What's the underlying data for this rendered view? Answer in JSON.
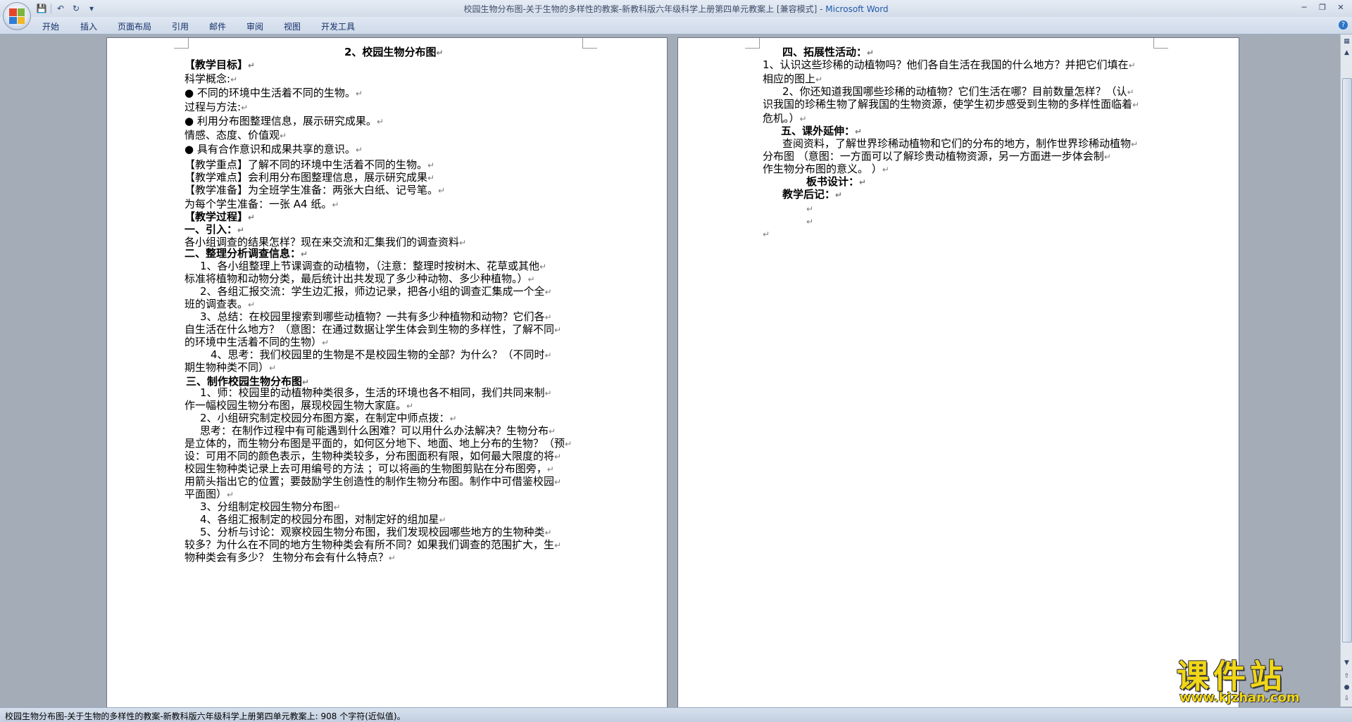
{
  "window": {
    "title": "校园生物分布图-关于生物的多样性的教案-新教科版六年级科学上册第四单元教案上 [兼容模式] - ",
    "app_name": "Microsoft Word"
  },
  "qat": [
    "save-icon",
    "undo-icon",
    "redo-icon",
    "customize-icon"
  ],
  "ribbon_tabs": [
    "开始",
    "插入",
    "页面布局",
    "引用",
    "邮件",
    "审阅",
    "视图",
    "开发工具"
  ],
  "left_page_lines": [
    {
      "text": "2、校园生物分布图",
      "b": true
    },
    {
      "text": "【教学目标】",
      "b": true
    },
    {
      "text": "科学概念:",
      "b": false
    },
    {
      "text": "● 不同的环境中生活着不同的生物。",
      "b": false
    },
    {
      "text": "过程与方法:",
      "b": false
    },
    {
      "text": "● 利用分布图整理信息，展示研究成果。",
      "b": false
    },
    {
      "text": "情感、态度、价值观",
      "b": false
    },
    {
      "text": "● 具有合作意识和成果共享的意识。",
      "b": false
    },
    {
      "text": "【教学重点】了解不同的环境中生活着不同的生物。",
      "b": false
    },
    {
      "text": "【教学难点】会利用分布图整理信息，展示研究成果",
      "b": false
    },
    {
      "text": "【教学准备】为全班学生准备：两张大白纸、记号笔。",
      "b": false
    },
    {
      "text": "为每个学生准备：一张 A4 纸。",
      "b": false
    },
    {
      "text": "【教学过程】",
      "b": true
    },
    {
      "text": "一、引入：",
      "b": true
    },
    {
      "text": "各小组调查的结果怎样？现在来交流和汇集我们的调查资料",
      "b": false
    },
    {
      "text": "二、整理分析调查信息：",
      "b": true
    },
    {
      "text": "1、各小组整理上节课调查的动植物，（注意：整理时按树木、花草或其他",
      "b": false
    },
    {
      "text": "标准将植物和动物分类，最后统计出共发现了多少种动物、多少种植物。）",
      "b": false
    },
    {
      "text": "2、各组汇报交流：学生边汇报，师边记录，把各小组的调查汇集成一个全",
      "b": false
    },
    {
      "text": "班的调查表。",
      "b": false
    },
    {
      "text": "3、总结：在校园里搜索到哪些动植物？一共有多少种植物和动物？它们各",
      "b": false
    },
    {
      "text": "自生活在什么地方？（意图：在通过数据让学生体会到生物的多样性，了解不同",
      "b": false
    },
    {
      "text": "的环境中生活着不同的生物）",
      "b": false
    },
    {
      "text": "4、思考：我们校园里的生物是不是校园生物的全部？为什么？（不同时",
      "b": false
    },
    {
      "text": "期生物种类不同）",
      "b": false
    },
    {
      "text": "三、制作校园生物分布图",
      "b": true
    },
    {
      "text": "1、师：校园里的动植物种类很多，生活的环境也各不相同，我们共同来制",
      "b": false
    },
    {
      "text": "作一幅校园生物分布图，展现校园生物大家庭。",
      "b": false
    },
    {
      "text": "2、小组研究制定校园分布图方案，在制定中师点拨：",
      "b": false
    },
    {
      "text": "思考：在制作过程中有可能遇到什么困难？可以用什么办法解决？生物分布",
      "b": false
    },
    {
      "text": "是立体的，而生物分布图是平面的，如何区分地下、地面、地上分布的生物？（预",
      "b": false
    },
    {
      "text": "设：可用不同的颜色表示，生物种类较多，分布图面积有限，如何最大限度的将",
      "b": false
    },
    {
      "text": "校园生物种类记录上去可用编号的方法 ；可以将画的生物图剪贴在分布图旁，",
      "b": false
    },
    {
      "text": "用箭头指出它的位置；要鼓励学生创造性的制作生物分布图。制作中可借鉴校园",
      "b": false
    },
    {
      "text": "平面图）",
      "b": false
    },
    {
      "text": "3、分组制定校园生物分布图",
      "b": false
    },
    {
      "text": "4、各组汇报制定的校园分布图，对制定好的组加星",
      "b": false
    },
    {
      "text": "5、分析与讨论：观察校园生物分布图，我们发现校园哪些地方的生物种类",
      "b": false
    },
    {
      "text": "较多？为什么在不同的地方生物种类会有所不同？如果我们调查的范围扩大，生",
      "b": false
    },
    {
      "text": "物种类会有多少？                生物分布会有什么特点？",
      "b": false
    }
  ],
  "right_page_lines": [
    {
      "text": "四、拓展性活动：",
      "b": true
    },
    {
      "text": "1、认识这些珍稀的动植物吗？他们各自生活在我国的什么地方？并把它们填在",
      "b": false
    },
    {
      "text": "相应的图上",
      "b": false
    },
    {
      "text": "2、你还知道我国哪些珍稀的动植物？它们生活在哪？目前数量怎样？（认",
      "b": false
    },
    {
      "text": "识我国的珍稀生物了解我国的生物资源，使学生初步感受到生物的多样性面临着",
      "b": false
    },
    {
      "text": "危机。）",
      "b": false
    },
    {
      "text": "五、课外延伸：",
      "b": true
    },
    {
      "text": "查阅资料，了解世界珍稀动植物和它们的分布的地方，制作世界珍稀动植物",
      "b": false
    },
    {
      "text": "分布图        （意图：一方面可以了解珍贵动植物资源，另一方面进一步体会制",
      "b": false
    },
    {
      "text": "作生物分布图的意义。   ）",
      "b": false
    },
    {
      "text": "板书设计：",
      "b": true
    },
    {
      "text": "教学后记：",
      "b": true
    },
    {
      "text": "",
      "b": false
    },
    {
      "text": "",
      "b": false
    },
    {
      "text": "",
      "b": false
    }
  ],
  "status": "校园生物分布图-关于生物的多样性的教案-新教科版六年级科学上册第四单元教案上: 908 个字符(近似值)。",
  "watermark": {
    "big": "课件站",
    "small": "www.kjzhan.com"
  }
}
